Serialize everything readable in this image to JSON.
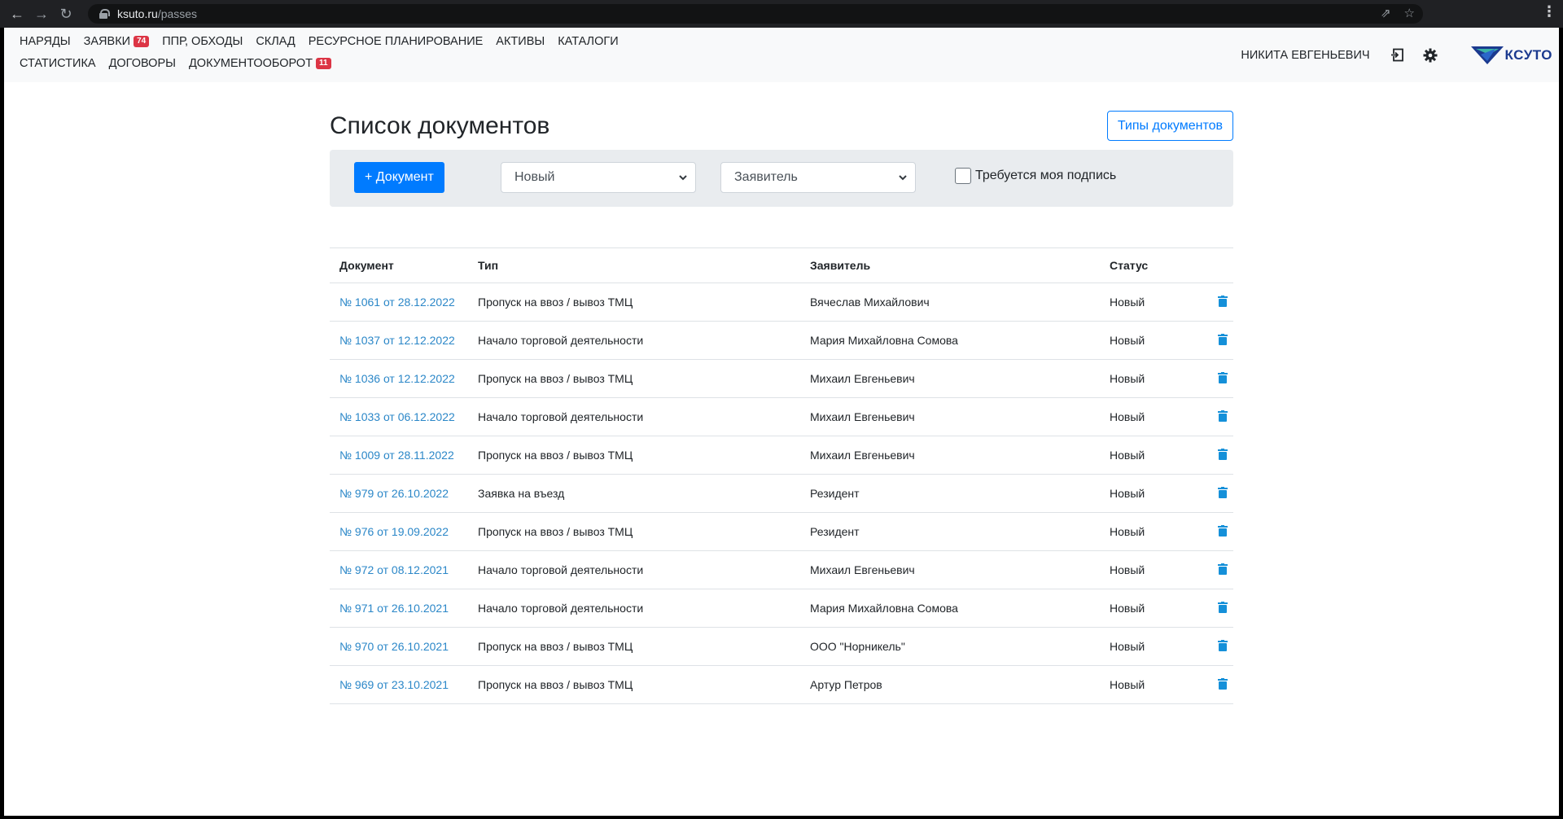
{
  "browser": {
    "url_host": "ksuto.ru",
    "url_path": "/passes"
  },
  "navbar": {
    "items": [
      {
        "label": "НАРЯДЫ"
      },
      {
        "label": "ЗАЯВКИ",
        "badge": "74"
      },
      {
        "label": "ППР, ОБХОДЫ"
      },
      {
        "label": "СКЛАД"
      },
      {
        "label": "РЕСУРСНОЕ ПЛАНИРОВАНИЕ"
      },
      {
        "label": "АКТИВЫ"
      },
      {
        "label": "КАТАЛОГИ"
      },
      {
        "label": "СТАТИСТИКА"
      },
      {
        "label": "ДОГОВОРЫ"
      },
      {
        "label": "ДОКУМЕНТООБОРОТ",
        "badge": "11"
      }
    ],
    "user_name": "НИКИТА ЕВГЕНЬЕВИЧ",
    "logo_text": "КСУТО"
  },
  "page": {
    "title": "Список документов",
    "types_button": "Типы документов"
  },
  "filters": {
    "add_button": "+ Документ",
    "status_select": "Новый",
    "applicant_select": "Заявитель",
    "signature_checkbox": "Требуется моя подпись"
  },
  "table": {
    "headers": {
      "document": "Документ",
      "type": "Тип",
      "applicant": "Заявитель",
      "status": "Статус"
    },
    "rows": [
      {
        "doc": "№ 1061 от 28.12.2022",
        "type": "Пропуск на ввоз / вывоз ТМЦ",
        "applicant": "Вячеслав Михайлович",
        "status": "Новый"
      },
      {
        "doc": "№ 1037 от 12.12.2022",
        "type": "Начало торговой деятельности",
        "applicant": "Мария Михайловна Сомова",
        "status": "Новый"
      },
      {
        "doc": "№ 1036 от 12.12.2022",
        "type": "Пропуск на ввоз / вывоз ТМЦ",
        "applicant": "Михаил Евгеньевич",
        "status": "Новый"
      },
      {
        "doc": "№ 1033 от 06.12.2022",
        "type": "Начало торговой деятельности",
        "applicant": "Михаил Евгеньевич",
        "status": "Новый"
      },
      {
        "doc": "№ 1009 от 28.11.2022",
        "type": "Пропуск на ввоз / вывоз ТМЦ",
        "applicant": "Михаил Евгеньевич",
        "status": "Новый"
      },
      {
        "doc": "№ 979 от 26.10.2022",
        "type": "Заявка на въезд",
        "applicant": "Резидент",
        "status": "Новый"
      },
      {
        "doc": "№ 976 от 19.09.2022",
        "type": "Пропуск на ввоз / вывоз ТМЦ",
        "applicant": "Резидент",
        "status": "Новый"
      },
      {
        "doc": "№ 972 от 08.12.2021",
        "type": "Начало торговой деятельности",
        "applicant": "Михаил Евгеньевич",
        "status": "Новый"
      },
      {
        "doc": "№ 971 от 26.10.2021",
        "type": "Начало торговой деятельности",
        "applicant": "Мария Михайловна Сомова",
        "status": "Новый"
      },
      {
        "doc": "№ 970 от 26.10.2021",
        "type": "Пропуск на ввоз / вывоз ТМЦ",
        "applicant": "ООО \"Норникель\"",
        "status": "Новый"
      },
      {
        "doc": "№ 969 от 23.10.2021",
        "type": "Пропуск на ввоз / вывоз ТМЦ",
        "applicant": "Артур Петров",
        "status": "Новый"
      }
    ]
  },
  "colors": {
    "primary": "#007bff",
    "link": "#2b87c8",
    "badge": "#dc3545",
    "trash": "#1590d9"
  }
}
